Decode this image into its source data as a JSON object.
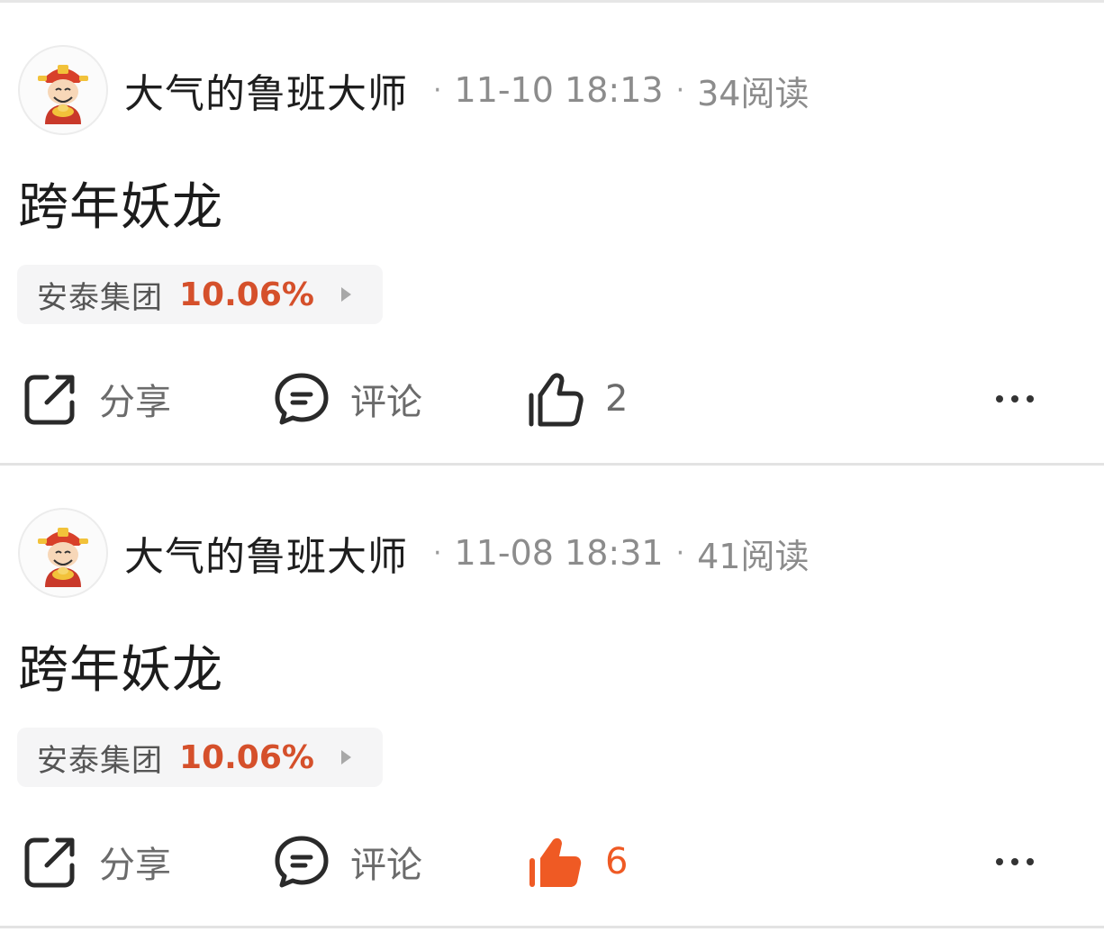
{
  "posts": [
    {
      "author": "大气的鲁班大师",
      "date": "11-10 18:13",
      "reads": "34阅读",
      "title": "跨年妖龙",
      "stock": {
        "name": "安泰集团",
        "change": "10.06%"
      },
      "actions": {
        "share": "分享",
        "comment": "评论",
        "likes": "2",
        "liked": false
      }
    },
    {
      "author": "大气的鲁班大师",
      "date": "11-08 18:31",
      "reads": "41阅读",
      "title": "跨年妖龙",
      "stock": {
        "name": "安泰集团",
        "change": "10.06%"
      },
      "actions": {
        "share": "分享",
        "comment": "评论",
        "likes": "6",
        "liked": true
      }
    }
  ],
  "colors": {
    "stock_up": "#d5502b",
    "liked": "#ef5a24",
    "meta": "#8c8c8c"
  },
  "icons": {
    "avatar": "caishen-avatar-icon",
    "share": "share-icon",
    "comment": "comment-icon",
    "like": "thumb-up-icon",
    "more": "more-dots-icon"
  }
}
